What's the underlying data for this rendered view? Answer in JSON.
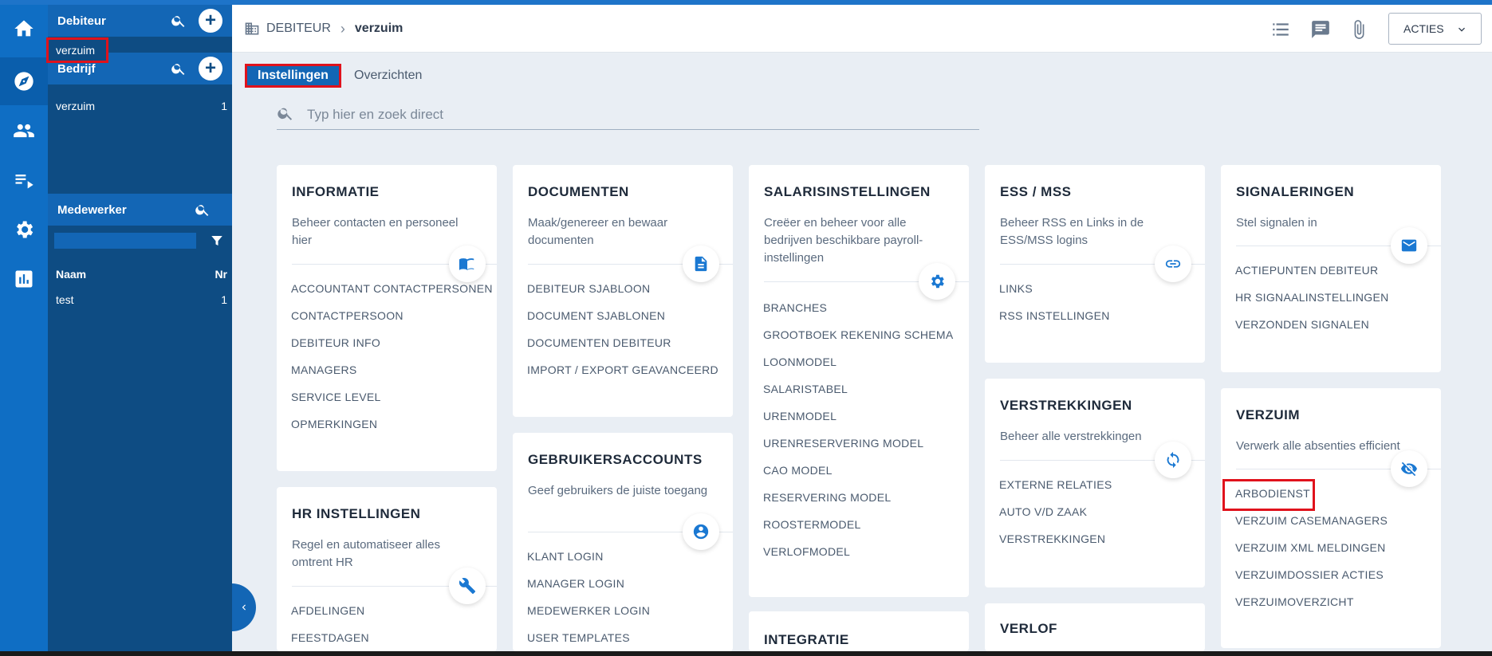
{
  "sidebar_rail": {
    "items": [
      {
        "icon": "home-icon"
      },
      {
        "icon": "compass-icon",
        "active": true
      },
      {
        "icon": "people-icon"
      },
      {
        "icon": "playlist-icon"
      },
      {
        "icon": "settings-icon"
      },
      {
        "icon": "chart-icon"
      }
    ]
  },
  "side_panel": {
    "debiteur": {
      "title": "Debiteur",
      "selected": "verzuim"
    },
    "bedrijf": {
      "title": "Bedrijf",
      "rows": [
        {
          "name": "verzuim",
          "nr": "1"
        }
      ]
    },
    "medewerker": {
      "title": "Medewerker",
      "columns": {
        "naam": "Naam",
        "nr": "Nr"
      },
      "rows": [
        {
          "name": "test",
          "nr": "1"
        }
      ]
    }
  },
  "header": {
    "breadcrumb": {
      "parent": "DEBITEUR",
      "current": "verzuim"
    },
    "acties_label": "ACTIES"
  },
  "tabs": {
    "active": "Instellingen",
    "other": "Overzichten"
  },
  "search": {
    "placeholder": "Typ hier en zoek direct"
  },
  "cards": {
    "informatie": {
      "title": "INFORMATIE",
      "desc": "Beheer contacten en personeel hier",
      "icon": "book-icon",
      "items": [
        "ACCOUNTANT CONTACTPERSONEN",
        "CONTACTPERSOON",
        "DEBITEUR INFO",
        "MANAGERS",
        "SERVICE LEVEL",
        "OPMERKINGEN"
      ]
    },
    "hr": {
      "title": "HR INSTELLINGEN",
      "desc": "Regel en automatiseer alles omtrent HR",
      "icon": "wrench-icon",
      "items": [
        "AFDELINGEN",
        "FEESTDAGEN"
      ]
    },
    "documenten": {
      "title": "DOCUMENTEN",
      "desc": "Maak/genereer en bewaar documenten",
      "icon": "document-icon",
      "items": [
        "DEBITEUR SJABLOON",
        "DOCUMENT SJABLONEN",
        "DOCUMENTEN DEBITEUR",
        "IMPORT / EXPORT GEAVANCEERD"
      ]
    },
    "gebruikers": {
      "title": "GEBRUIKERSACCOUNTS",
      "desc": "Geef gebruikers de juiste toegang",
      "icon": "account-icon",
      "items": [
        "KLANT LOGIN",
        "MANAGER LOGIN",
        "MEDEWERKER LOGIN",
        "USER TEMPLATES"
      ]
    },
    "salaris": {
      "title": "SALARISINSTELLINGEN",
      "desc": "Creëer en beheer voor alle bedrijven beschikbare payroll-instellingen",
      "icon": "gear-icon",
      "items": [
        "BRANCHES",
        "GROOTBOEK REKENING SCHEMA",
        "LOONMODEL",
        "SALARISTABEL",
        "URENMODEL",
        "URENRESERVERING MODEL",
        "CAO MODEL",
        "RESERVERING MODEL",
        "ROOSTERMODEL",
        "VERLOFMODEL"
      ]
    },
    "integratie": {
      "title": "INTEGRATIE"
    },
    "ess": {
      "title": "ESS / MSS",
      "desc": "Beheer RSS en Links in de ESS/MSS logins",
      "icon": "link-icon",
      "items": [
        "LINKS",
        "RSS INSTELLINGEN"
      ]
    },
    "verstrekkingen": {
      "title": "VERSTREKKINGEN",
      "desc": "Beheer alle verstrekkingen",
      "icon": "sync-icon",
      "items": [
        "EXTERNE RELATIES",
        "AUTO V/D ZAAK",
        "VERSTREKKINGEN"
      ]
    },
    "verlof": {
      "title": "VERLOF"
    },
    "signaleringen": {
      "title": "SIGNALERINGEN",
      "desc": "Stel signalen in",
      "icon": "mail-icon",
      "items": [
        "ACTIEPUNTEN DEBITEUR",
        "HR SIGNAALINSTELLINGEN",
        "VERZONDEN SIGNALEN"
      ]
    },
    "verzuim": {
      "title": "VERZUIM",
      "desc": "Verwerk alle absenties efficient",
      "icon": "eye-off-icon",
      "items": [
        "ARBODIENST",
        "VERZUIM CASEMANAGERS",
        "VERZUIM XML MELDINGEN",
        "VERZUIMDOSSIER ACTIES",
        "VERZUIMOVERZICHT"
      ]
    }
  },
  "colors": {
    "accent": "#1366b5",
    "rail": "#0f6ec4",
    "panel": "#0e4c83",
    "highlight": "#e0121c"
  }
}
